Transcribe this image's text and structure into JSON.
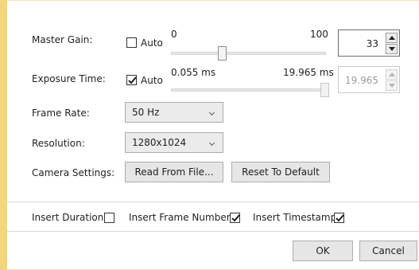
{
  "master_gain": {
    "label": "Master Gain:",
    "auto_label": "Auto",
    "auto_checked": false,
    "slider_min_label": "0",
    "slider_max_label": "100",
    "slider_value": 33,
    "value": "33"
  },
  "exposure_time": {
    "label": "Exposure Time:",
    "auto_label": "Auto",
    "auto_checked": true,
    "slider_min_label": "0.055 ms",
    "slider_max_label": "19.965 ms",
    "slider_fraction": 1.0,
    "value": "19.965"
  },
  "frame_rate": {
    "label": "Frame Rate:",
    "selected": "50 Hz"
  },
  "resolution": {
    "label": "Resolution:",
    "selected": "1280x1024"
  },
  "camera_settings": {
    "label": "Camera Settings:",
    "read_button": "Read From File...",
    "reset_button": "Reset To Default"
  },
  "options": {
    "insert_duration": {
      "label": "Insert Duration",
      "checked": false
    },
    "insert_frame_number": {
      "label": "Insert Frame Number",
      "checked": true
    },
    "insert_timestamp": {
      "label": "Insert Timestamp",
      "checked": true
    }
  },
  "footer": {
    "ok_label": "OK",
    "cancel_label": "Cancel"
  }
}
